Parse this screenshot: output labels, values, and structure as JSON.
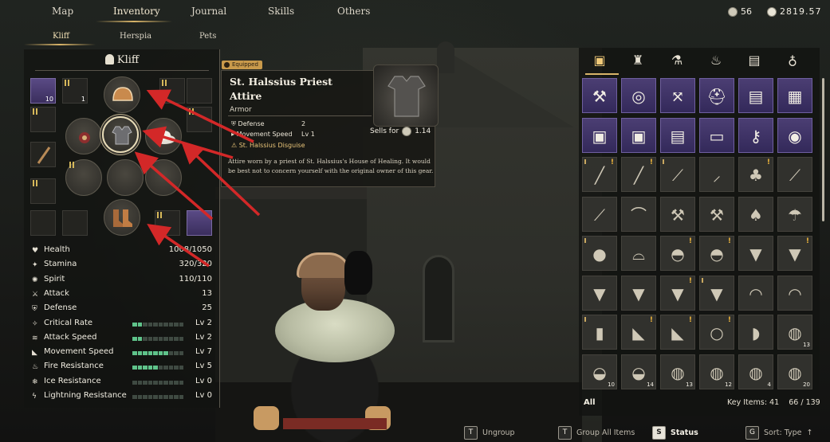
{
  "nav": {
    "tabs": [
      {
        "label": "Map"
      },
      {
        "label": "Inventory"
      },
      {
        "label": "Journal"
      },
      {
        "label": "Skills"
      },
      {
        "label": "Others"
      }
    ],
    "active_tab": "Inventory"
  },
  "party": {
    "tabs": [
      {
        "label": "Kliff"
      },
      {
        "label": "Herspia"
      },
      {
        "label": "Pets"
      }
    ],
    "active": "Kliff"
  },
  "currency": {
    "silver": "56",
    "gold": "2819.57"
  },
  "character": {
    "name": "Kliff",
    "slot_quantities": {
      "accessory_1": "10",
      "accessory_2": "1"
    }
  },
  "stats": [
    {
      "icon": "heart-icon",
      "label": "Health",
      "value": "1008/1050"
    },
    {
      "icon": "stamina-icon",
      "label": "Stamina",
      "value": "320/320"
    },
    {
      "icon": "spirit-icon",
      "label": "Spirit",
      "value": "110/110"
    },
    {
      "icon": "sword-icon",
      "label": "Attack",
      "value": "13"
    },
    {
      "icon": "shield-icon",
      "label": "Defense",
      "value": "25"
    },
    {
      "icon": "crit-icon",
      "label": "Critical Rate",
      "value": "Lv 2",
      "level": 2
    },
    {
      "icon": "attack-speed-icon",
      "label": "Attack Speed",
      "value": "Lv 2",
      "level": 2
    },
    {
      "icon": "boot-icon",
      "label": "Movement Speed",
      "value": "Lv 7",
      "level": 7
    },
    {
      "icon": "flame-icon",
      "label": "Fire Resistance",
      "value": "Lv 5",
      "level": 5
    },
    {
      "icon": "snowflake-icon",
      "label": "Ice Resistance",
      "value": "Lv 0",
      "level": 0
    },
    {
      "icon": "lightning-icon",
      "label": "Lightning Resistance",
      "value": "Lv 0",
      "level": 0
    }
  ],
  "tooltip": {
    "badge": "Equipped",
    "title": "St. Halssius Priest Attire",
    "type": "Armor",
    "rows": [
      {
        "label": "Defense",
        "value": "2"
      },
      {
        "label": "Movement Speed",
        "value": "Lv 1"
      }
    ],
    "set_name": "St. Halssius Disguise",
    "sells_label": "Sells for",
    "sells_value": "1.14",
    "description": "Attire worn by a priest of St. Halssius's House of Healing. It would be best not to concern yourself with the original owner of this gear."
  },
  "inventory": {
    "categories": [
      {
        "icon": "bag-icon"
      },
      {
        "icon": "armor-icon"
      },
      {
        "icon": "potion-icon"
      },
      {
        "icon": "cooking-pot-icon"
      },
      {
        "icon": "scroll-icon"
      },
      {
        "icon": "sack-icon"
      }
    ],
    "filter_label": "All",
    "key_items_label": "Key Items: 41",
    "capacity": "66 / 139",
    "cells": [
      {
        "g": "⚒",
        "p": true
      },
      {
        "g": "◎",
        "p": true
      },
      {
        "g": "⤧",
        "p": true
      },
      {
        "g": "⛑",
        "p": true
      },
      {
        "g": "▤",
        "p": true
      },
      {
        "g": "▦",
        "p": true
      },
      {
        "g": "▣",
        "p": true
      },
      {
        "g": "▣",
        "p": true
      },
      {
        "g": "▤",
        "p": true
      },
      {
        "g": "▭",
        "p": true
      },
      {
        "g": "⚷",
        "p": true
      },
      {
        "g": "◉",
        "p": true
      },
      {
        "g": "╱",
        "m": "!",
        "t": true
      },
      {
        "g": "╱",
        "m": "!"
      },
      {
        "g": "⟋",
        "t": true
      },
      {
        "g": "⸝"
      },
      {
        "g": "♣",
        "m": "!"
      },
      {
        "g": "⟋"
      },
      {
        "g": "⟋"
      },
      {
        "g": "⌒"
      },
      {
        "g": "⚒"
      },
      {
        "g": "⚒"
      },
      {
        "g": "♠"
      },
      {
        "g": "☂"
      },
      {
        "g": "●",
        "t": true
      },
      {
        "g": "⌓"
      },
      {
        "g": "◓",
        "m": "!"
      },
      {
        "g": "◓",
        "m": "!"
      },
      {
        "g": "▼"
      },
      {
        "g": "▼",
        "m": "!"
      },
      {
        "g": "▼"
      },
      {
        "g": "▼"
      },
      {
        "g": "▼",
        "m": "!"
      },
      {
        "g": "▼",
        "t": true
      },
      {
        "g": "◠"
      },
      {
        "g": "◠"
      },
      {
        "g": "▮",
        "t": true
      },
      {
        "g": "◣",
        "m": "!"
      },
      {
        "g": "◣",
        "m": "!"
      },
      {
        "g": "○",
        "m": "!"
      },
      {
        "g": "◗"
      },
      {
        "g": "◍",
        "q": "13"
      },
      {
        "g": "◒",
        "q": "10"
      },
      {
        "g": "◒",
        "q": "14"
      },
      {
        "g": "◍",
        "q": "13"
      },
      {
        "g": "◍",
        "q": "12"
      },
      {
        "g": "◍",
        "q": "4"
      },
      {
        "g": "◍",
        "q": "20"
      }
    ]
  },
  "actions": [
    {
      "key": "T",
      "label": "Ungroup"
    },
    {
      "key": "T",
      "label": "Group All Items"
    },
    {
      "key": "S",
      "label": "Status"
    },
    {
      "key": "G",
      "label": "Sort: Type"
    }
  ]
}
